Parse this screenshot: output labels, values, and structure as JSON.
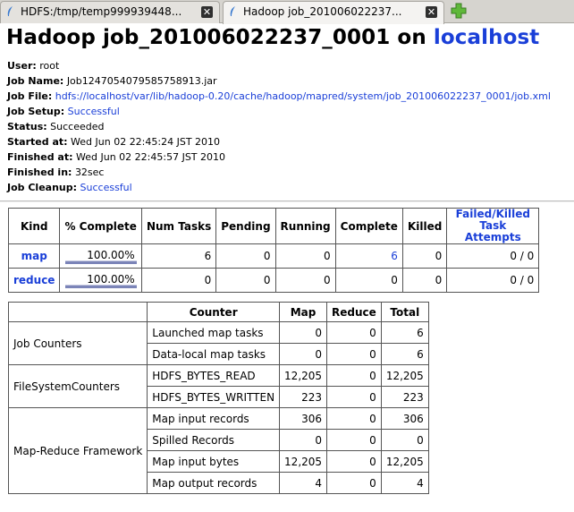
{
  "tabs": [
    {
      "label": "HDFS:/tmp/temp999939448...",
      "active": false
    },
    {
      "label": "Hadoop job_201006022237...",
      "active": true
    }
  ],
  "page": {
    "title_prefix": "Hadoop job_201006022237_0001 on ",
    "title_host": "localhost"
  },
  "info": {
    "user_label": "User:",
    "user": "root",
    "jobname_label": "Job Name:",
    "jobname": "Job1247054079585758913.jar",
    "jobfile_label": "Job File:",
    "jobfile": "hdfs://localhost/var/lib/hadoop-0.20/cache/hadoop/mapred/system/job_201006022237_0001/job.xml",
    "setup_label": "Job Setup:",
    "setup": "Successful",
    "status_label": "Status:",
    "status": "Succeeded",
    "started_label": "Started at:",
    "started": "Wed Jun 02 22:45:24 JST 2010",
    "finished_label": "Finished at:",
    "finished": "Wed Jun 02 22:45:57 JST 2010",
    "finishedin_label": "Finished in:",
    "finishedin": "32sec",
    "cleanup_label": "Job Cleanup:",
    "cleanup": "Successful"
  },
  "tasks": {
    "headers": [
      "Kind",
      "% Complete",
      "Num Tasks",
      "Pending",
      "Running",
      "Complete",
      "Killed",
      "Failed/Killed Task Attempts"
    ],
    "rows": [
      {
        "kind": "map",
        "pct": "100.00%",
        "pct_value": 1.0,
        "num": "6",
        "pending": "0",
        "running": "0",
        "complete": "6",
        "killed": "0",
        "failed": "0 / 0"
      },
      {
        "kind": "reduce",
        "pct": "100.00%",
        "pct_value": 1.0,
        "num": "0",
        "pending": "0",
        "running": "0",
        "complete": "0",
        "killed": "0",
        "failed": "0 / 0"
      }
    ]
  },
  "counters": {
    "headers": [
      "Counter",
      "Map",
      "Reduce",
      "Total"
    ],
    "groups": [
      {
        "name": "Job Counters",
        "rows": [
          {
            "name": "Launched map tasks",
            "map": "0",
            "reduce": "0",
            "total": "6"
          },
          {
            "name": "Data-local map tasks",
            "map": "0",
            "reduce": "0",
            "total": "6"
          }
        ]
      },
      {
        "name": "FileSystemCounters",
        "rows": [
          {
            "name": "HDFS_BYTES_READ",
            "map": "12,205",
            "reduce": "0",
            "total": "12,205"
          },
          {
            "name": "HDFS_BYTES_WRITTEN",
            "map": "223",
            "reduce": "0",
            "total": "223"
          }
        ]
      },
      {
        "name": "Map-Reduce Framework",
        "rows": [
          {
            "name": "Map input records",
            "map": "306",
            "reduce": "0",
            "total": "306"
          },
          {
            "name": "Spilled Records",
            "map": "0",
            "reduce": "0",
            "total": "0"
          },
          {
            "name": "Map input bytes",
            "map": "12,205",
            "reduce": "0",
            "total": "12,205"
          },
          {
            "name": "Map output records",
            "map": "4",
            "reduce": "0",
            "total": "4"
          }
        ]
      }
    ]
  },
  "colors": {
    "link": "#1a3fd8",
    "progress": "#7b84b8"
  }
}
